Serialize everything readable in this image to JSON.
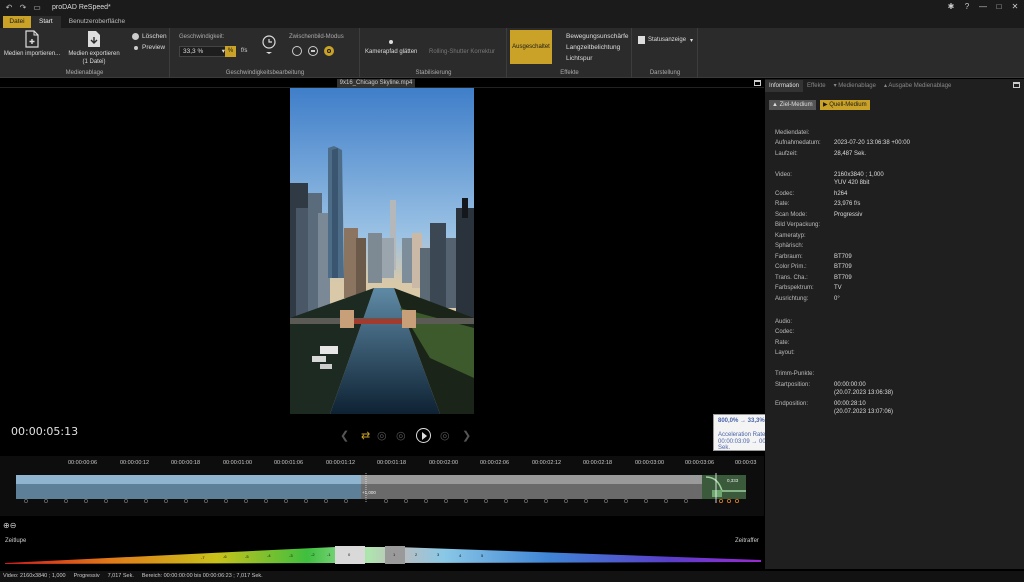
{
  "app": {
    "title": "proDAD ReSpeed*",
    "window_controls": [
      "✱",
      "?",
      "—",
      "□",
      "✕"
    ]
  },
  "menu_tabs": {
    "file": "Datei",
    "start": "Start",
    "ui": "Benutzeroberfläche"
  },
  "ribbon": {
    "import_label": "Medien importieren...",
    "export_label": "Medien exportieren",
    "export_sub": "(1 Datei)",
    "delete_label": "Löschen",
    "preview_label": "Preview",
    "medienablage": "Medienablage",
    "speed_label": "Geschwindigkeit:",
    "speed_value": "33,3 %",
    "percent_btn": "%",
    "fps_label": "f/s",
    "interframe_label": "Zwischenbild-Modus",
    "speed_group": "Geschwindigkeitsbearbeitung",
    "camera_smooth": "Kamerapfad glätten",
    "rolling_shutter": "Rolling-Shutter Korrektur",
    "stab_group": "Stabilisierung",
    "off_btn": "Ausgeschaltet",
    "motion_blur": "Bewegungsunschärfe",
    "long_exposure": "Langzeitbelichtung",
    "light_trail": "Lichtspur",
    "effects_group": "Effekte",
    "status_display": "Statusanzeige",
    "display_group": "Darstellung"
  },
  "viewer": {
    "file_tab": "9x16_Chicago Skyline.mp4",
    "timecode": "00:00:05:13"
  },
  "tooltip": {
    "line1": "800,0% → 33,3%",
    "line2": "Acceleration Rate: -143,05 1/s²",
    "line3": "00:00:03:09 → 00:00:03:13 ⌛ 0,167 Sek."
  },
  "timeline": {
    "ticks": [
      "00:00:00:06",
      "00:00:00:12",
      "00:00:00:18",
      "00:00:01:00",
      "00:00:01:06",
      "00:00:01:12",
      "00:00:01:18",
      "00:00:02:00",
      "00:00:02:06",
      "00:00:02:12",
      "00:00:02:18",
      "00:00:03:00",
      "00:00:03:06",
      "00:00:03"
    ],
    "marker_label": "+1,000",
    "end_label": "0,333"
  },
  "ramp": {
    "left_label": "Zeitlupe",
    "right_label": "Zeitraffer",
    "segments": [
      "-7",
      "-6",
      "-5",
      "-4",
      "-3",
      "-2",
      "-1",
      "0",
      "1",
      "2",
      "3",
      "4",
      "5"
    ]
  },
  "statusbar": {
    "video": "Video: 2160x3840 ; 1,000",
    "scan": "Progressiv",
    "duration": "7,017 Sek.",
    "range": "Bereich: 00:00:00:00 bis 00:00:06:23 ; 7,017 Sek."
  },
  "right_panel": {
    "tabs": [
      "Information",
      "Effekte",
      "Medienablage",
      "Ausgabe Medienablage"
    ],
    "btn_target": "Ziel-Medium",
    "btn_source": "Quell-Medium",
    "section_media": "Mediendatei:",
    "rows": [
      {
        "label": "Aufnahmedatum:",
        "value": "2023-07-20 13:06:38 +00:00"
      },
      {
        "label": "Laufzeit:",
        "value": "28,487 Sek."
      },
      {
        "label": "Video:",
        "value": "2160x3840 ; 1,000"
      },
      {
        "label": "",
        "value": "YUV 420 8bit"
      },
      {
        "label": "Codec:",
        "value": "h264"
      },
      {
        "label": "Rate:",
        "value": "23,976 f/s"
      },
      {
        "label": "Scan Mode:",
        "value": "Progressiv"
      },
      {
        "label": "Bild Verpackung:",
        "value": ""
      },
      {
        "label": "Kameratyp:",
        "value": ""
      },
      {
        "label": "Sphärisch:",
        "value": ""
      },
      {
        "label": "Farbraum:",
        "value": "BT709"
      },
      {
        "label": "Color Prim.:",
        "value": "BT709"
      },
      {
        "label": "Trans. Cha.:",
        "value": "BT709"
      },
      {
        "label": "Farbspektrum:",
        "value": "TV"
      },
      {
        "label": "Ausrichtung:",
        "value": "0°"
      },
      {
        "label": "Audio:",
        "value": ""
      },
      {
        "label": "Codec:",
        "value": ""
      },
      {
        "label": "Rate:",
        "value": ""
      },
      {
        "label": "Layout:",
        "value": ""
      },
      {
        "label": "Trimm-Punkte:",
        "value": ""
      },
      {
        "label": "Startposition:",
        "value": "00:00:00:00"
      },
      {
        "label": "",
        "value": "(20.07.2023 13:06:38)"
      },
      {
        "label": "Endposition:",
        "value": "00:00:28:10"
      },
      {
        "label": "",
        "value": "(20.07.2023 13:07:06)"
      }
    ]
  },
  "colors": {
    "accent": "#c9a227",
    "clip_blue": "#8fb4cf",
    "clip_grey": "#9a9a9a",
    "clip_green": "#6fa86f"
  }
}
